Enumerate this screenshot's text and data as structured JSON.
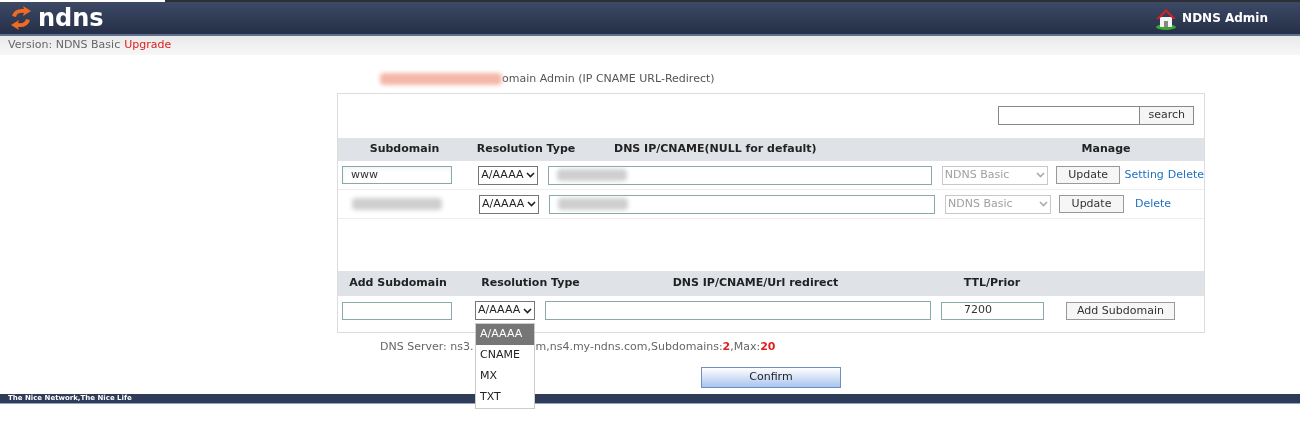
{
  "header": {
    "logo_text": "ndns",
    "admin_label": "NDNS Admin"
  },
  "version_bar": {
    "label": "Version: NDNS Basic",
    "upgrade_link": "Upgrade"
  },
  "page_title": "omain Admin (IP CNAME URL-Redirect)",
  "search": {
    "button": "search"
  },
  "records_table": {
    "columns": [
      "Subdomain",
      "Resolution Type",
      "DNS IP/CNAME(NULL for default)",
      "Manage"
    ],
    "rows": [
      {
        "subdomain": "www",
        "type": "A/AAAA",
        "plan": "NDNS Basic",
        "update": "Update",
        "links": [
          "Setting",
          "Delete"
        ]
      },
      {
        "type": "A/AAAA",
        "plan": "NDNS Basic",
        "update": "Update",
        "links": [
          "Delete"
        ]
      }
    ]
  },
  "add_table": {
    "columns": [
      "Add Subdomain",
      "Resolution Type",
      "DNS IP/CNAME/Url redirect",
      "TTL/Prior"
    ],
    "type": "A/AAAA",
    "ttl": "7200",
    "button": "Add Subdomain",
    "type_options": [
      {
        "label": "A/AAAA",
        "selected": true
      },
      {
        "label": "CNAME",
        "selected": false
      },
      {
        "label": "MX",
        "selected": false
      },
      {
        "label": "TXT",
        "selected": false
      }
    ]
  },
  "dns_server": {
    "before": "DNS Server: ns3.",
    "after": "m,ns4.my-ndns.com,Subdomains:",
    "count": "2",
    "max_label": ",Max:",
    "max": "20"
  },
  "confirm_button": "Confirm",
  "footer": "The Nice Network,The Nice Life"
}
